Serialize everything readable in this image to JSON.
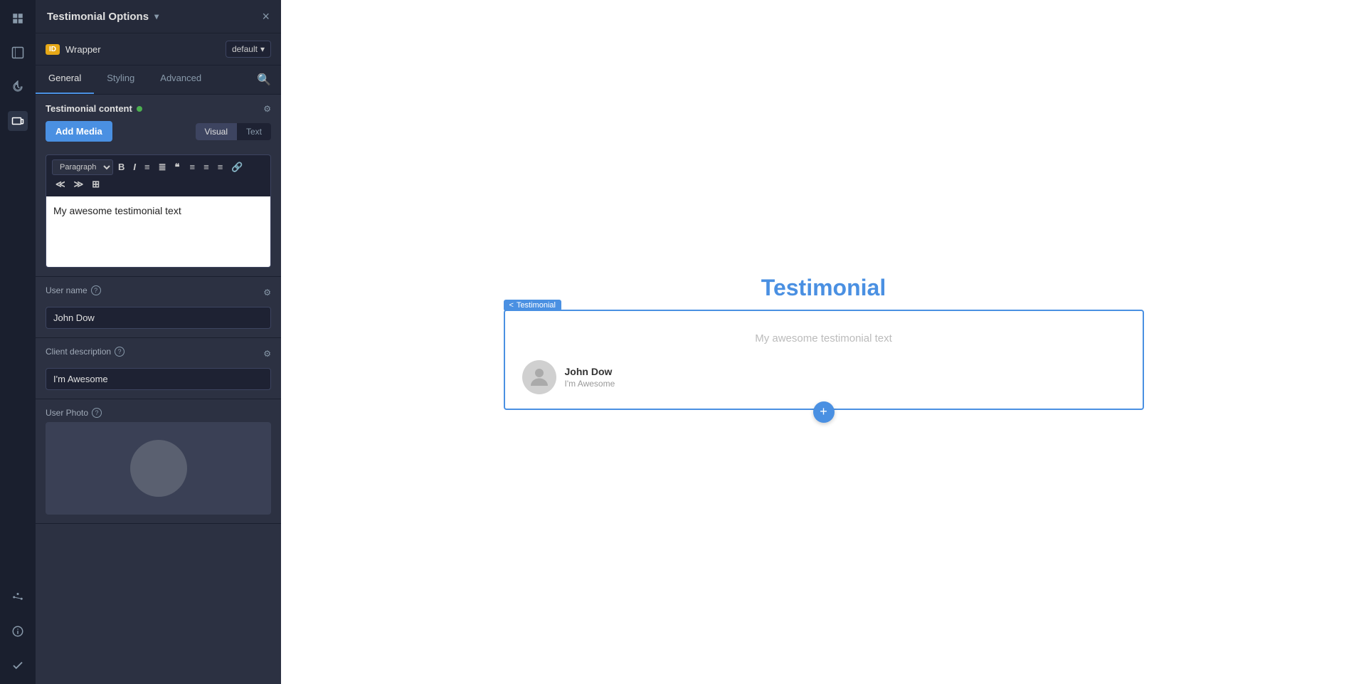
{
  "sidebar": {
    "icons": [
      {
        "name": "dashboard-icon",
        "symbol": "⊞",
        "active": false
      },
      {
        "name": "pages-icon",
        "symbol": "◧",
        "active": false
      },
      {
        "name": "history-icon",
        "symbol": "↺",
        "active": false
      },
      {
        "name": "responsive-icon",
        "symbol": "▭",
        "active": true
      },
      {
        "name": "settings-icon",
        "symbol": "⚙",
        "active": false
      },
      {
        "name": "info-icon",
        "symbol": "ℹ",
        "active": false
      },
      {
        "name": "check-icon",
        "symbol": "✓",
        "active": false
      }
    ]
  },
  "panel": {
    "title": "Testimonial Options",
    "chevron": "▾",
    "close_label": "×",
    "wrapper": {
      "badge": "ID",
      "label": "Wrapper",
      "select_value": "default",
      "select_chevron": "▾"
    },
    "tabs": [
      {
        "label": "General",
        "active": true
      },
      {
        "label": "Styling",
        "active": false
      },
      {
        "label": "Advanced",
        "active": false
      }
    ],
    "search_icon": "🔍",
    "testimonial_content": {
      "section_title": "Testimonial content",
      "has_dot": true,
      "add_media_label": "Add Media",
      "visual_label": "Visual",
      "text_label": "Text",
      "toolbar": {
        "paragraph_label": "Paragraph",
        "bold": "B",
        "italic": "I",
        "unordered_list": "≡",
        "ordered_list": "≣",
        "blockquote": "❝",
        "align_left": "≡",
        "align_center": "≡",
        "align_right": "≡",
        "link": "🔗",
        "indent_less": "≪",
        "indent_more": "≫",
        "table": "⊞"
      },
      "editor_content": "My awesome testimonial text"
    },
    "user_name": {
      "label": "User name",
      "value": "John Dow"
    },
    "client_description": {
      "label": "Client description",
      "value": "I'm Awesome"
    },
    "user_photo": {
      "label": "User Photo"
    }
  },
  "canvas": {
    "title": "Testimonial",
    "testimonial_badge": "< Testimonial",
    "card": {
      "text": "My awesome testimonial text",
      "author_name": "John Dow",
      "author_desc": "I'm Awesome",
      "add_btn": "+"
    }
  }
}
